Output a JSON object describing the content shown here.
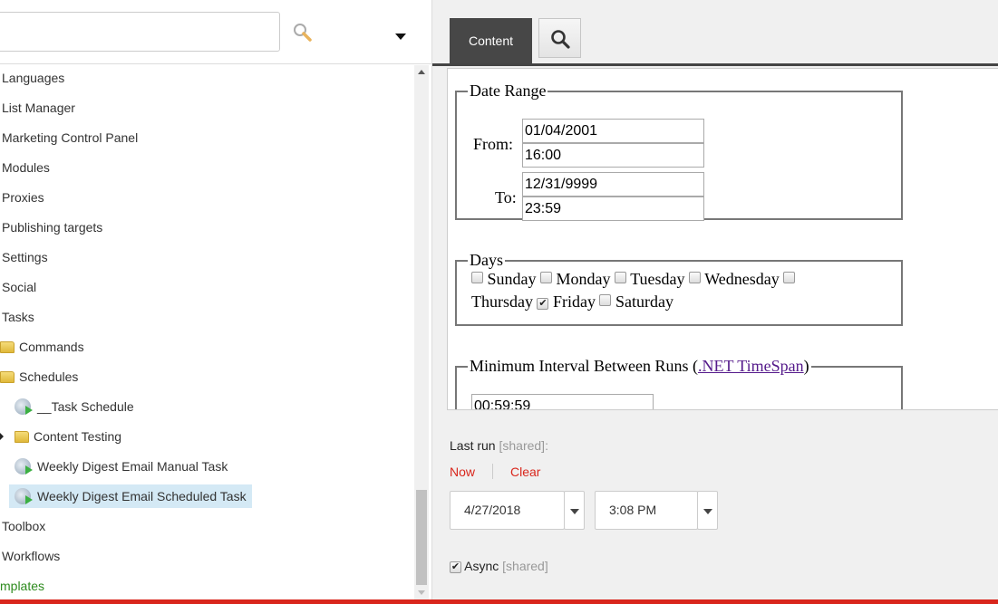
{
  "tree": {
    "search_value": "",
    "items": [
      {
        "label": "Languages",
        "type": "item"
      },
      {
        "label": "List Manager",
        "type": "item"
      },
      {
        "label": "Marketing Control Panel",
        "type": "item"
      },
      {
        "label": "Modules",
        "type": "item"
      },
      {
        "label": "Proxies",
        "type": "item"
      },
      {
        "label": "Publishing targets",
        "type": "item"
      },
      {
        "label": "Settings",
        "type": "item"
      },
      {
        "label": "Social",
        "type": "item"
      },
      {
        "label": "Tasks",
        "type": "item"
      },
      {
        "label": "Commands",
        "type": "folder"
      },
      {
        "label": "Schedules",
        "type": "folder"
      },
      {
        "label": "__Task Schedule",
        "type": "task"
      },
      {
        "label": "Content Testing",
        "type": "folder"
      },
      {
        "label": "Weekly Digest Email Manual Task",
        "type": "task"
      },
      {
        "label": "Weekly Digest Email Scheduled Task",
        "type": "task",
        "selected": true
      },
      {
        "label": "Toolbox",
        "type": "item"
      },
      {
        "label": "Workflows",
        "type": "item"
      },
      {
        "label": "mplates",
        "type": "item",
        "color": "#2e8b1e"
      }
    ]
  },
  "tabs": {
    "content": "Content"
  },
  "date_range": {
    "legend": "Date Range",
    "from_label": "From:",
    "from_date": "01/04/2001",
    "from_time": "16:00",
    "to_label": "To:",
    "to_date": "12/31/9999",
    "to_time": "23:59"
  },
  "days": {
    "legend": "Days",
    "items": [
      {
        "label": "Sunday",
        "checked": false
      },
      {
        "label": "Monday",
        "checked": false
      },
      {
        "label": "Tuesday",
        "checked": false
      },
      {
        "label": "Wednesday",
        "checked": false
      },
      {
        "label": "Thursday",
        "checked": false
      },
      {
        "label": "Friday",
        "checked": true
      },
      {
        "label": "Saturday",
        "checked": false
      }
    ]
  },
  "interval": {
    "legend": "Minimum Interval Between Runs (",
    "link": ".NET TimeSpan",
    "legend_end": ")",
    "value": "00:59:59"
  },
  "last_run": {
    "label": "Last run",
    "shared": "[shared]:",
    "now": "Now",
    "clear": "Clear",
    "date": "4/27/2018",
    "time": "3:08 PM"
  },
  "async": {
    "label": "Async",
    "shared": "[shared]",
    "checked": true
  },
  "colors": {
    "accent_red": "#d9261c",
    "tab_dark": "#474747",
    "selected_row": "#d4e9f5"
  }
}
